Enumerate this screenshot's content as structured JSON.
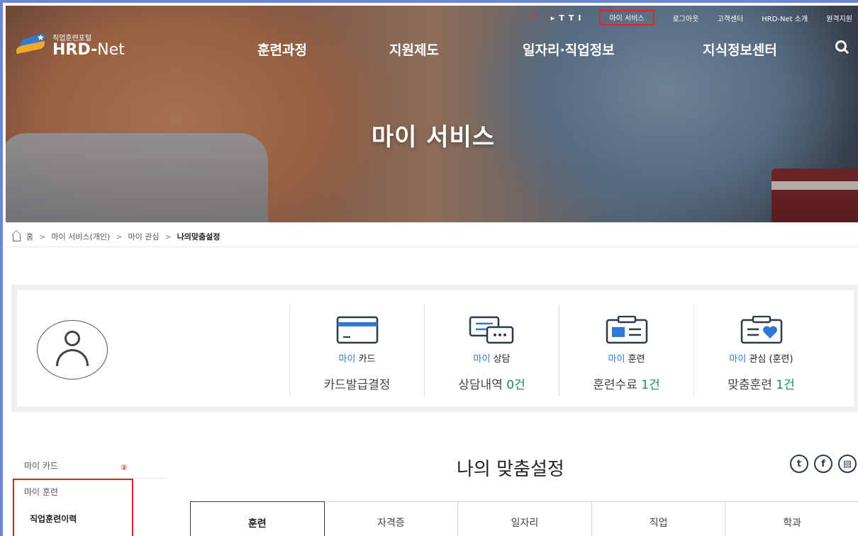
{
  "topbar": {
    "size_buttons": [
      "▸",
      "T",
      "T",
      "I"
    ],
    "marker": "①",
    "my_service": "마이 서비스",
    "logout": "로그아웃",
    "customer_center": "고객센터",
    "about": "HRD-Net 소개",
    "remote_support": "원격지원"
  },
  "logo": {
    "small": "직업훈련포털",
    "big_hrd": "HRD",
    "big_net": "Net"
  },
  "gnb": {
    "items": [
      "훈련과정",
      "지원제도",
      "일자리·직업정보",
      "지식정보센터"
    ]
  },
  "hero": {
    "title": "마이 서비스"
  },
  "breadcrumb": {
    "home": "홈",
    "items": [
      "마이 서비스(개인)",
      "마이 관심",
      "나의맞춤설정"
    ],
    "separator": ">"
  },
  "summary": {
    "cards": [
      {
        "icon": "card-icon",
        "label_my": "마이",
        "label_rest": "카드",
        "value_text": "카드발급결정",
        "value_num": ""
      },
      {
        "icon": "chat-icon",
        "label_my": "마이",
        "label_rest": "상담",
        "value_text": "상담내역 ",
        "value_num": "0건"
      },
      {
        "icon": "training-icon",
        "label_my": "마이",
        "label_rest": "훈련",
        "value_text": "훈련수료 ",
        "value_num": "1건"
      },
      {
        "icon": "heart-card-icon",
        "label_my": "마이",
        "label_rest": "관심 (훈련)",
        "value_text": "맞춤훈련 ",
        "value_num": "1건"
      }
    ]
  },
  "sidebar": {
    "my_card": "마이 카드",
    "marker": "②",
    "my_training": "마이 훈련",
    "training_history": "직업훈련이력"
  },
  "main": {
    "title": "나의 맞춤설정",
    "share_icons": [
      "twitter-icon",
      "facebook-icon",
      "print-icon"
    ],
    "tabs": [
      "훈련",
      "자격증",
      "일자리",
      "직업",
      "학과"
    ]
  },
  "colors": {
    "accent_blue": "#2d7bd6",
    "accent_green": "#1d8a6a",
    "marker_red": "#d42a2a"
  }
}
